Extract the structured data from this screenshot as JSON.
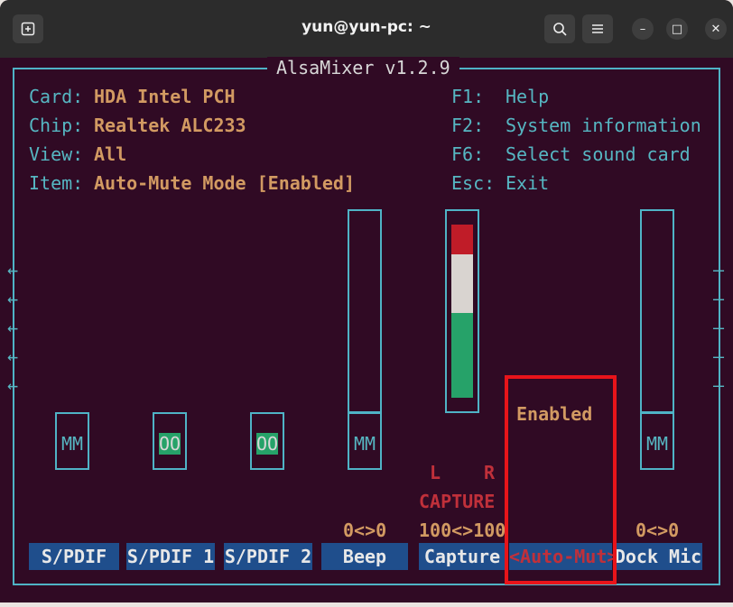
{
  "window": {
    "title": "yun@yun-pc: ~",
    "new_tab_icon": "new-tab-icon",
    "search_icon": "search-icon",
    "menu_icon": "hamburger-menu-icon",
    "minimize_glyph": "–",
    "maximize_glyph": "□",
    "close_glyph": "✕"
  },
  "alsamixer": {
    "heading": "AlsaMixer v1.2.9",
    "info": [
      {
        "key": "Card:",
        "value": "HDA Intel PCH"
      },
      {
        "key": "Chip:",
        "value": "Realtek ALC233"
      },
      {
        "key": "View:",
        "value": "All"
      },
      {
        "key": "Item:",
        "value": "Auto-Mute Mode [Enabled]"
      }
    ],
    "keys": [
      {
        "key": "F1:",
        "value": "Help"
      },
      {
        "key": "F2:",
        "value": "System information"
      },
      {
        "key": "F6:",
        "value": "Select sound card"
      },
      {
        "key": "Esc:",
        "value": "Exit"
      }
    ],
    "controls": [
      {
        "name": "S/PDIF",
        "mute": "MM",
        "value": ""
      },
      {
        "name": "S/PDIF 1",
        "mute": "OO",
        "value": ""
      },
      {
        "name": "S/PDIF 2",
        "mute": "OO",
        "value": ""
      },
      {
        "name": "Beep",
        "mute": "MM",
        "value": "0<>0"
      },
      {
        "name": "Capture",
        "capture_label": "CAPTURE",
        "left": "L",
        "right": "R",
        "value": "100<>100",
        "level": 1.0
      },
      {
        "name": "<Auto-Mut>",
        "state": "Enabled"
      },
      {
        "name": "Dock Mic",
        "mute": "MM",
        "value": "0<>0"
      }
    ],
    "scroll_left_arrows": [
      "←",
      "←",
      "←",
      "←",
      "←"
    ],
    "scroll_right_arrows": [
      "–",
      "–",
      "–",
      "–",
      "–"
    ]
  },
  "colors": {
    "terminal_bg": "#300a24",
    "border": "#4fb3c6",
    "label_bg": "#1f4e8c",
    "highlight": "#e8141a"
  }
}
